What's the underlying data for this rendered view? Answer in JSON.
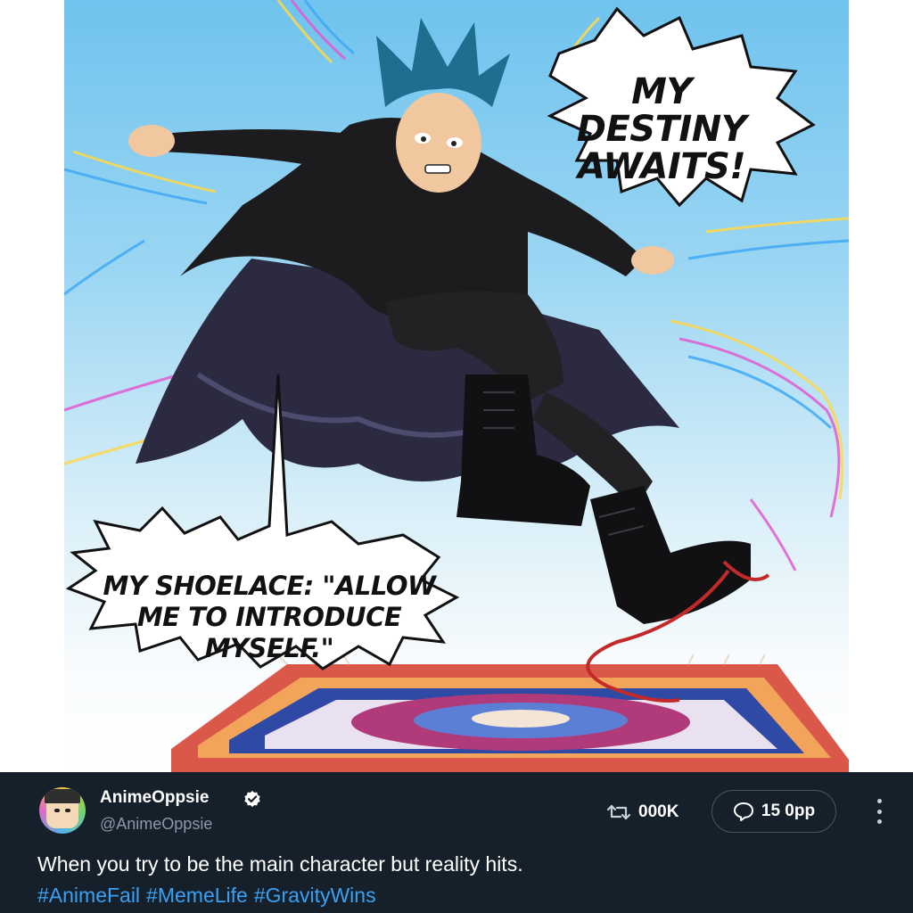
{
  "image": {
    "bubble_top": "MY DESTINY AWAITS!",
    "bubble_bottom": "MY SHOELACE: \"ALLOW ME TO INTRODUCE MYSELF.\""
  },
  "tweet": {
    "display_name": "AnimeOppsie",
    "handle": "@AnimeOppsie",
    "verified_icon": "verified-badge-icon",
    "retweet_icon": "retweet-icon",
    "retweet_count": "000K",
    "reply_icon": "reply-icon",
    "reply_count": "15 0pp",
    "more_icon": "more-vertical-icon",
    "text": "When you try to be the main character but reality hits.",
    "hashtags": [
      "#AnimeFail",
      "#MemeLife",
      "#GravityWins"
    ]
  },
  "colors": {
    "bar_background": "#15202b",
    "hashtag": "#3aa0f2",
    "handle": "#8b98a5",
    "sky": "#6fc3ee"
  }
}
